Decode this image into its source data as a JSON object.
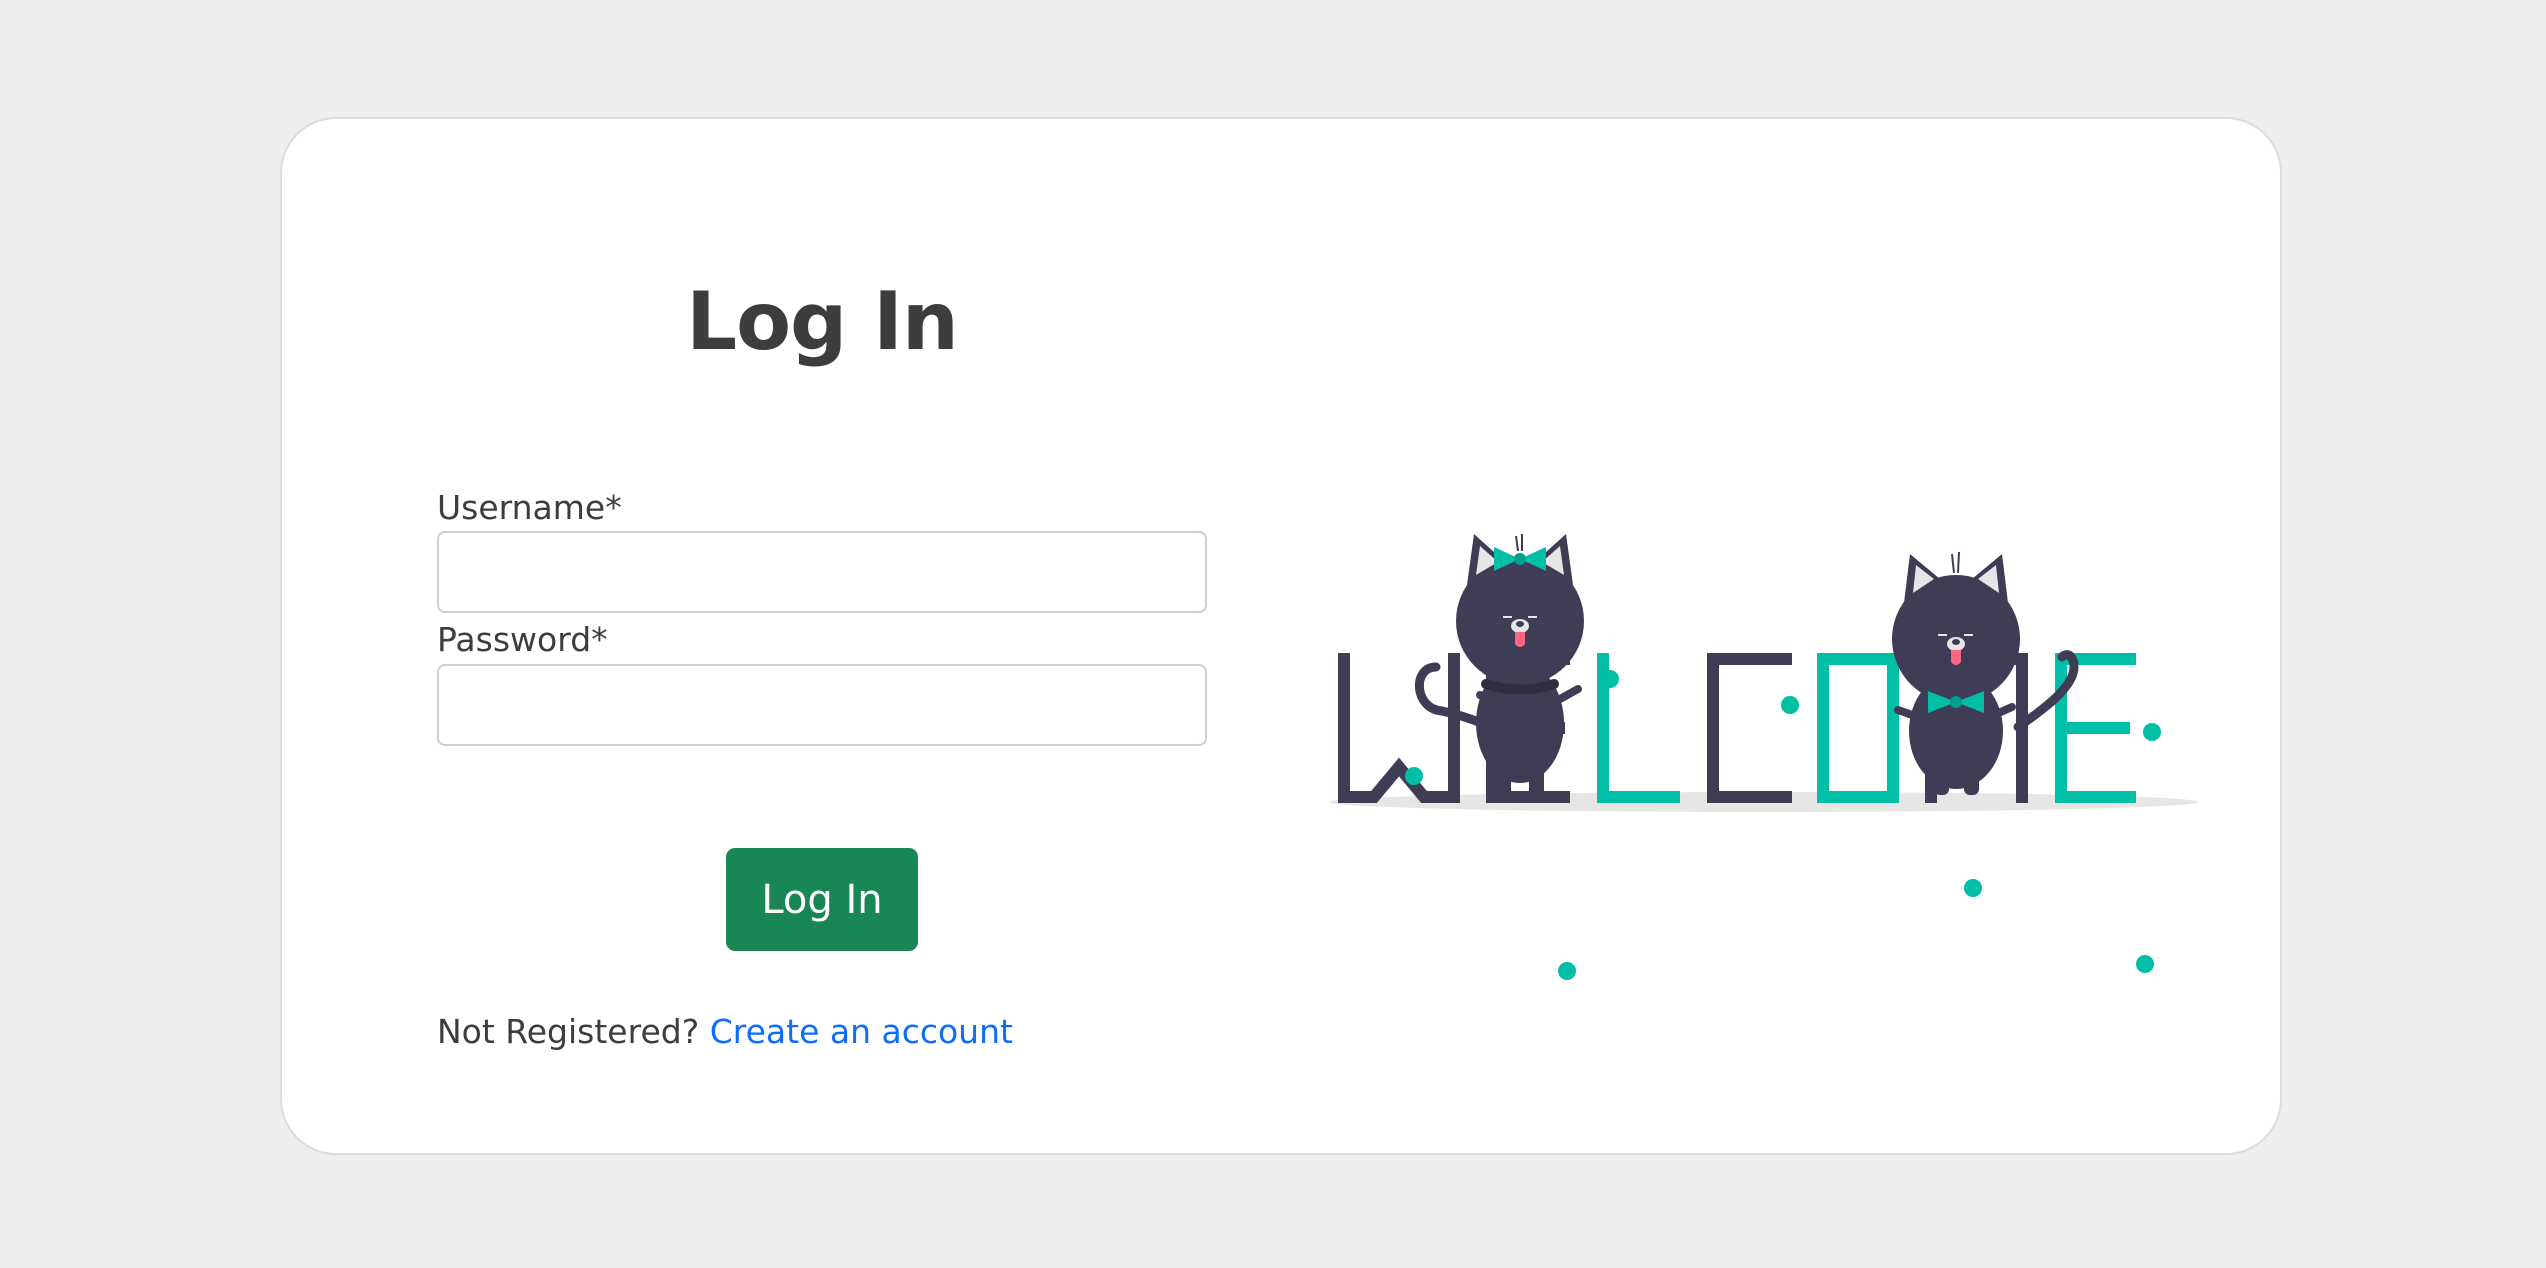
{
  "login": {
    "title": "Log In",
    "username_label": "Username*",
    "username_value": "",
    "password_label": "Password*",
    "password_value": "",
    "submit_label": "Log In",
    "not_registered_text": "Not Registered?",
    "create_account_link": "Create an account"
  },
  "illustration": {
    "word": "WELCOME",
    "subject": "two cartoon cats sitting on welcome letters",
    "colors": {
      "dark": "#3f3d56",
      "accent": "#00bfa6",
      "shadow": "#e6e6e6"
    }
  },
  "colors": {
    "background": "#eeeeee",
    "card": "#ffffff",
    "primary_button": "#198754",
    "link": "#0d6efd",
    "text": "#3d3d3d"
  }
}
